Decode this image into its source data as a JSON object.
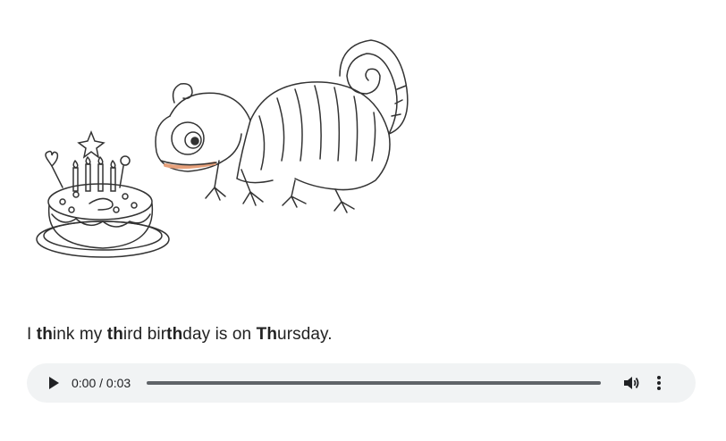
{
  "sentence": {
    "parts": [
      {
        "text": "I ",
        "bold": false
      },
      {
        "text": "th",
        "bold": true
      },
      {
        "text": "ink my ",
        "bold": false
      },
      {
        "text": "th",
        "bold": true
      },
      {
        "text": "ird bir",
        "bold": false
      },
      {
        "text": "th",
        "bold": true
      },
      {
        "text": "day is on ",
        "bold": false
      },
      {
        "text": "Th",
        "bold": true
      },
      {
        "text": "ursday.",
        "bold": false
      }
    ]
  },
  "audio": {
    "time_label": "0:00 / 0:03",
    "progress": 0
  },
  "icons": {
    "play": "play-icon",
    "volume": "volume-icon",
    "more": "more-vert-icon"
  },
  "colors": {
    "player_bg": "#f1f3f4",
    "accent": "#202124"
  }
}
